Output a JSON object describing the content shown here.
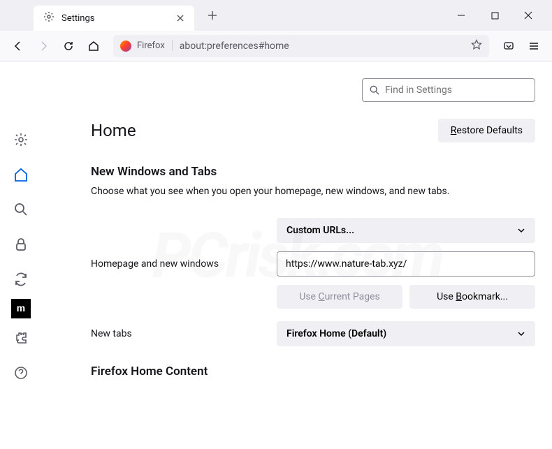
{
  "window": {
    "tab_label": "Settings",
    "url_brand": "Firefox",
    "url": "about:preferences#home"
  },
  "search": {
    "placeholder": "Find in Settings"
  },
  "page": {
    "title": "Home",
    "restore_label": "Restore Defaults"
  },
  "section1": {
    "title": "New Windows and Tabs",
    "description": "Choose what you see when you open your homepage, new windows, and new tabs."
  },
  "homepage": {
    "label": "Homepage and new windows",
    "dropdown": "Custom URLs...",
    "url_value": "https://www.nature-tab.xyz/",
    "use_current": "Use Current Pages",
    "use_bookmark": "Use Bookmark..."
  },
  "newtabs": {
    "label": "New tabs",
    "dropdown": "Firefox Home (Default)"
  },
  "section2": {
    "title": "Firefox Home Content"
  },
  "watermark": "PCrisk.com"
}
